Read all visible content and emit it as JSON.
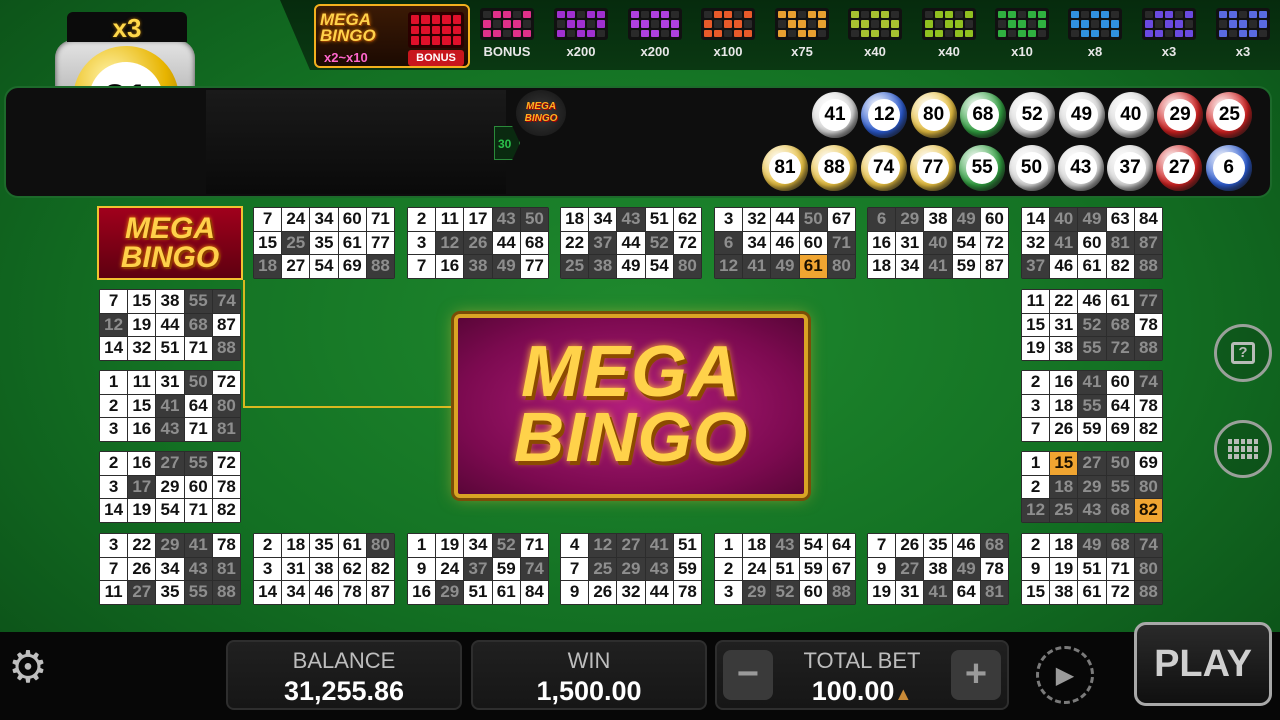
{
  "ball_counter": {
    "multiplier": "x3",
    "current_ball": "81"
  },
  "mega_pattern": {
    "logo": "MEGA BINGO",
    "multiplier": "x2~x10",
    "label": "BONUS"
  },
  "patterns": [
    {
      "label": "BONUS",
      "color": "#e0308a"
    },
    {
      "label": "x200",
      "color": "#a030d0"
    },
    {
      "label": "x200",
      "color": "#b040e0"
    },
    {
      "label": "x100",
      "color": "#e85a2a"
    },
    {
      "label": "x75",
      "color": "#e8a030"
    },
    {
      "label": "x40",
      "color": "#a8c030"
    },
    {
      "label": "x40",
      "color": "#90c020"
    },
    {
      "label": "x10",
      "color": "#30b040"
    },
    {
      "label": "x8",
      "color": "#3090e0"
    },
    {
      "label": "x3",
      "color": "#6a4ae0"
    },
    {
      "label": "x3",
      "color": "#5a6ae0"
    }
  ],
  "draw_panel": {
    "remaining_label": "30",
    "mini_logo": "MEGA BINGO"
  },
  "drawn_balls_row1": [
    {
      "n": "41",
      "c": "#d8d8d8"
    },
    {
      "n": "12",
      "c": "#2a5ad0"
    },
    {
      "n": "80",
      "c": "#e8c040"
    },
    {
      "n": "68",
      "c": "#30a040"
    },
    {
      "n": "52",
      "c": "#d8d8d8"
    },
    {
      "n": "49",
      "c": "#d8d8d8"
    },
    {
      "n": "40",
      "c": "#d8d8d8"
    },
    {
      "n": "29",
      "c": "#d02020"
    },
    {
      "n": "25",
      "c": "#d02020"
    }
  ],
  "drawn_balls_row2": [
    {
      "n": "81",
      "c": "#e8c040"
    },
    {
      "n": "88",
      "c": "#e8c040"
    },
    {
      "n": "74",
      "c": "#e8c040"
    },
    {
      "n": "77",
      "c": "#e8c040"
    },
    {
      "n": "55",
      "c": "#30a040"
    },
    {
      "n": "50",
      "c": "#d8d8d8"
    },
    {
      "n": "43",
      "c": "#d8d8d8"
    },
    {
      "n": "37",
      "c": "#d8d8d8"
    },
    {
      "n": "27",
      "c": "#d02020"
    },
    {
      "n": "6",
      "c": "#2a5ad0"
    }
  ],
  "mega_card_label": "MEGA BINGO",
  "banner": {
    "line1": "MEGA",
    "line2": "BINGO"
  },
  "cards": [
    {
      "cells": [
        "7",
        "24",
        "34",
        "60",
        "71",
        "15",
        "25",
        "35",
        "61",
        "77",
        "18",
        "27",
        "54",
        "69",
        "88"
      ],
      "state": "uuuuuumuuumuuum"
    },
    {
      "cells": [
        "2",
        "11",
        "17",
        "43",
        "50",
        "3",
        "12",
        "26",
        "44",
        "68",
        "7",
        "16",
        "38",
        "49",
        "77"
      ],
      "state": "uuummummuuuumm"
    },
    {
      "cells": [
        "18",
        "34",
        "43",
        "51",
        "62",
        "22",
        "37",
        "44",
        "52",
        "72",
        "25",
        "38",
        "49",
        "54",
        "80"
      ],
      "state": "uumuuumumummuum"
    },
    {
      "cells": [
        "3",
        "32",
        "44",
        "50",
        "67",
        "6",
        "34",
        "46",
        "60",
        "71",
        "12",
        "41",
        "49",
        "61",
        "80"
      ],
      "state": "uuumumuuummmmhm"
    },
    {
      "cells": [
        "6",
        "29",
        "38",
        "49",
        "60",
        "16",
        "31",
        "40",
        "54",
        "72",
        "18",
        "34",
        "41",
        "59",
        "87"
      ],
      "state": "mmumuuumuuuumuu"
    },
    {
      "cells": [
        "14",
        "40",
        "49",
        "63",
        "84",
        "32",
        "41",
        "60",
        "81",
        "87",
        "37",
        "46",
        "61",
        "82",
        "88"
      ],
      "state": "ummuuumummmuuum"
    },
    {
      "cells": [
        "7",
        "15",
        "38",
        "55",
        "74",
        "12",
        "19",
        "44",
        "68",
        "87",
        "14",
        "32",
        "51",
        "71",
        "88"
      ],
      "state": "uuummmuumuuuuum"
    },
    {
      "cells": [
        "11",
        "22",
        "46",
        "61",
        "77",
        "15",
        "31",
        "52",
        "68",
        "78",
        "19",
        "38",
        "55",
        "72",
        "88"
      ],
      "state": "uuuumuummuuummm"
    },
    {
      "cells": [
        "1",
        "11",
        "31",
        "50",
        "72",
        "2",
        "15",
        "41",
        "64",
        "80",
        "3",
        "16",
        "43",
        "71",
        "81"
      ],
      "state": "uuumuuumumuumum"
    },
    {
      "cells": [
        "2",
        "16",
        "41",
        "60",
        "74",
        "3",
        "18",
        "55",
        "64",
        "78",
        "7",
        "26",
        "59",
        "69",
        "82"
      ],
      "state": "uumumuumuuuuuuu"
    },
    {
      "cells": [
        "2",
        "16",
        "27",
        "55",
        "72",
        "3",
        "17",
        "29",
        "60",
        "78",
        "14",
        "19",
        "54",
        "71",
        "82"
      ],
      "state": "uummuumuuuuuuuu"
    },
    {
      "cells": [
        "1",
        "15",
        "27",
        "50",
        "69",
        "2",
        "18",
        "29",
        "55",
        "80",
        "12",
        "25",
        "43",
        "68",
        "82"
      ],
      "state": "uhmmuummmmmmmmh"
    },
    {
      "cells": [
        "3",
        "22",
        "29",
        "41",
        "78",
        "7",
        "26",
        "34",
        "43",
        "81",
        "11",
        "27",
        "35",
        "55",
        "88"
      ],
      "state": "uummuuuummumumm"
    },
    {
      "cells": [
        "2",
        "18",
        "35",
        "61",
        "80",
        "3",
        "31",
        "38",
        "62",
        "82",
        "14",
        "34",
        "46",
        "78",
        "87"
      ],
      "state": "uuuumuuuuuuuuuu"
    },
    {
      "cells": [
        "1",
        "19",
        "34",
        "52",
        "71",
        "9",
        "24",
        "37",
        "59",
        "74",
        "16",
        "29",
        "51",
        "61",
        "84"
      ],
      "state": "uuumuuumumumuuu"
    },
    {
      "cells": [
        "4",
        "12",
        "27",
        "41",
        "51",
        "7",
        "25",
        "29",
        "43",
        "59",
        "9",
        "26",
        "32",
        "44",
        "78"
      ],
      "state": "ummmuummmuuuuuu"
    },
    {
      "cells": [
        "1",
        "18",
        "43",
        "54",
        "64",
        "2",
        "24",
        "51",
        "59",
        "67",
        "3",
        "29",
        "52",
        "60",
        "88"
      ],
      "state": "uumuuuuuuuummum"
    },
    {
      "cells": [
        "7",
        "26",
        "35",
        "46",
        "68",
        "9",
        "27",
        "38",
        "49",
        "78",
        "19",
        "31",
        "41",
        "64",
        "81"
      ],
      "state": "uuuumumumuuumum"
    },
    {
      "cells": [
        "2",
        "18",
        "49",
        "68",
        "74",
        "9",
        "19",
        "51",
        "71",
        "80",
        "15",
        "38",
        "61",
        "72",
        "88"
      ],
      "state": "uummmuuuumuuuum"
    }
  ],
  "bottom": {
    "balance_label": "BALANCE",
    "balance": "31,255.86",
    "win_label": "WIN",
    "win": "1,500.00",
    "bet_label": "TOTAL BET",
    "bet": "100.00",
    "minus": "−",
    "plus": "+",
    "play": "PLAY"
  },
  "icons": {
    "settings": "gear-icon",
    "help": "help-icon",
    "cards_view": "grid-icon",
    "autoplay": "autoplay-icon"
  }
}
